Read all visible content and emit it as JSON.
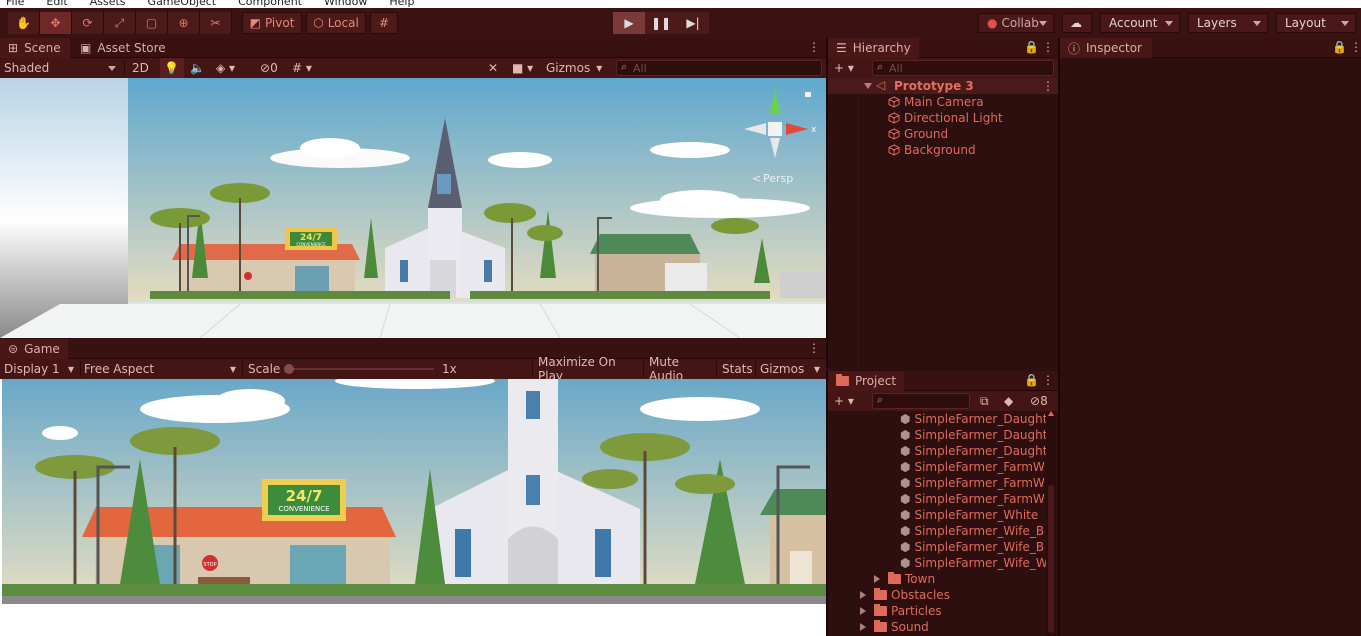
{
  "menu": [
    "File",
    "Edit",
    "Assets",
    "GameObject",
    "Component",
    "Window",
    "Help"
  ],
  "toolbar": {
    "pivot_label": "Pivot",
    "local_label": "Local",
    "collab_label": "Collab",
    "account_label": "Account",
    "layers_label": "Layers",
    "layout_label": "Layout"
  },
  "scene": {
    "tab_scene": "Scene",
    "tab_asset_store": "Asset Store",
    "shading_mode": "Shaded",
    "mode_2d": "2D",
    "hidden_count": "0",
    "gizmos_label": "Gizmos",
    "search_placeholder": "All",
    "persp_label": "Persp",
    "gizmo_axes": {
      "y": "y",
      "x": "x"
    },
    "sign_label": "24/7",
    "sign_sub": "CONVENIENCE",
    "stop_label": "STOP"
  },
  "game": {
    "tab_label": "Game",
    "display": "Display 1",
    "aspect": "Free Aspect",
    "scale_label": "Scale",
    "scale_value": "1x",
    "maximize_label": "Maximize On Play",
    "mute_label": "Mute Audio",
    "stats_label": "Stats",
    "gizmos_label": "Gizmos",
    "sign_label": "24/7",
    "sign_sub": "CONVENIENCE",
    "stop_label": "STOP"
  },
  "hierarchy": {
    "tab_label": "Hierarchy",
    "search_placeholder": "All",
    "scene_name": "Prototype 3",
    "items": [
      "Main Camera",
      "Directional Light",
      "Ground",
      "Background"
    ]
  },
  "inspector": {
    "tab_label": "Inspector"
  },
  "project": {
    "tab_label": "Project",
    "hidden_count": "8",
    "assets": [
      "SimpleFarmer_Daught",
      "SimpleFarmer_Daught",
      "SimpleFarmer_Daught",
      "SimpleFarmer_FarmW",
      "SimpleFarmer_FarmW",
      "SimpleFarmer_FarmW",
      "SimpleFarmer_White",
      "SimpleFarmer_Wife_B",
      "SimpleFarmer_Wife_B",
      "SimpleFarmer_Wife_W"
    ],
    "folders": [
      "Town",
      "Obstacles",
      "Particles",
      "Sound"
    ]
  },
  "colors": {
    "accent": "#e06a5a",
    "panel_bg": "#2e0f0f",
    "toolbar_bg": "#3b1212",
    "sky_top": "#5fa8cf",
    "sky_bottom": "#e4dcc0"
  }
}
